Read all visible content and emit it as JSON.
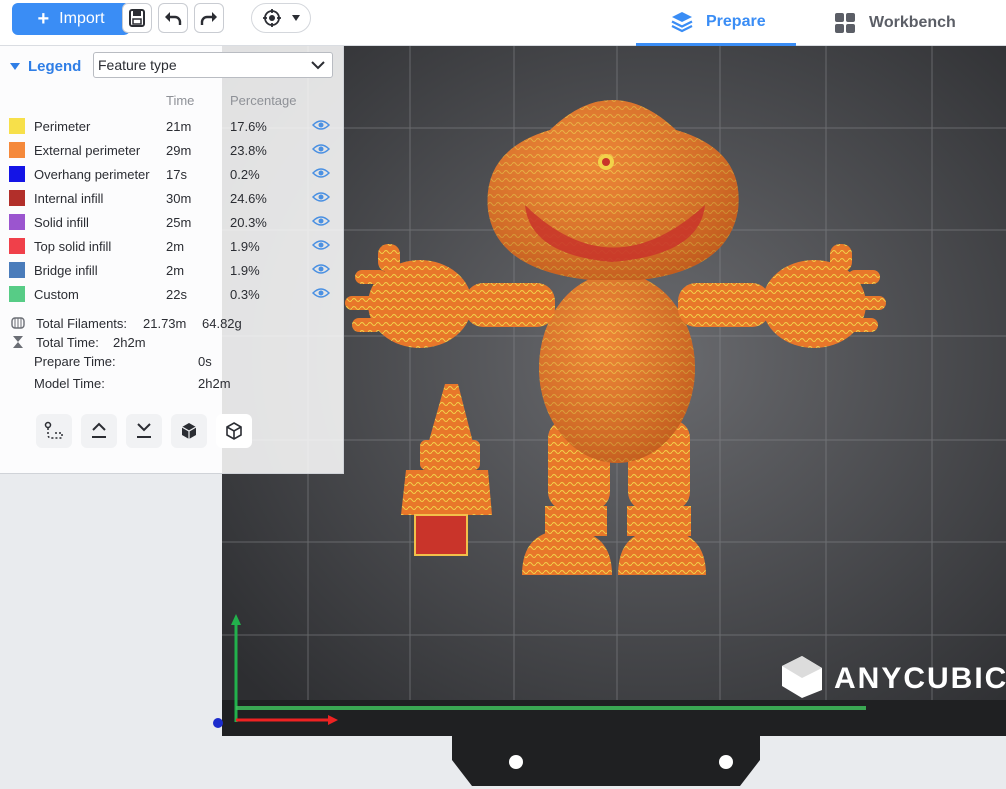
{
  "toolbar": {
    "import_label": "Import",
    "tabs": [
      {
        "label": "Prepare",
        "active": true
      },
      {
        "label": "Workbench",
        "active": false
      }
    ],
    "accent_color": "#3a8df5"
  },
  "legend": {
    "title": "Legend",
    "view_type": "Feature type",
    "columns": {
      "time": "Time",
      "percentage": "Percentage"
    },
    "items": [
      {
        "name": "Perimeter",
        "time": "21m",
        "percentage": "17.6%",
        "color": "#f7e04a"
      },
      {
        "name": "External perimeter",
        "time": "29m",
        "percentage": "23.8%",
        "color": "#f5893b"
      },
      {
        "name": "Overhang perimeter",
        "time": "17s",
        "percentage": "0.2%",
        "color": "#1414e6"
      },
      {
        "name": "Internal infill",
        "time": "30m",
        "percentage": "24.6%",
        "color": "#b22f2a"
      },
      {
        "name": "Solid infill",
        "time": "25m",
        "percentage": "20.3%",
        "color": "#9b55cf"
      },
      {
        "name": "Top solid infill",
        "time": "2m",
        "percentage": "1.9%",
        "color": "#f0404a"
      },
      {
        "name": "Bridge infill",
        "time": "2m",
        "percentage": "1.9%",
        "color": "#4a7cbb"
      },
      {
        "name": "Custom",
        "time": "22s",
        "percentage": "0.3%",
        "color": "#57cc86"
      }
    ],
    "total_filaments_label": "Total Filaments:",
    "total_filaments_length": "21.73m",
    "total_filaments_weight": "64.82g",
    "total_time_label": "Total Time:",
    "total_time_value": "2h2m",
    "prepare_time_label": "Prepare Time:",
    "prepare_time_value": "0s",
    "model_time_label": "Model Time:",
    "model_time_value": "2h2m"
  },
  "viewport": {
    "brand_logo_text": "ANYCUBIC",
    "model_color": "#e8772a",
    "model_highlight": "#f2d24a"
  }
}
